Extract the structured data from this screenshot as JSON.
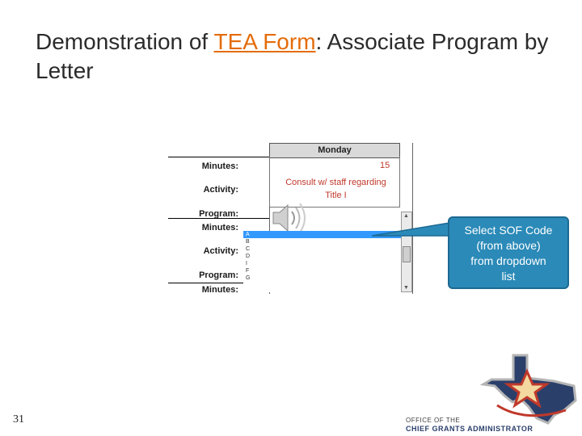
{
  "slide": {
    "title_prefix": "Demonstration of ",
    "title_link": "TEA Form",
    "title_suffix": ": Associate Program by Letter",
    "number": "31"
  },
  "form": {
    "column_header": "Monday",
    "labels": {
      "minutes_1": "Minutes:",
      "activity_1": "Activity:",
      "program_1": "Program:",
      "minutes_2": "Minutes:",
      "activity_2": "Activity:",
      "program_2": "Program:",
      "minutes_3": "Minutes:"
    },
    "minutes_value": "15",
    "activity_line1": "Consult w/ staff regarding",
    "activity_line2": "Title I",
    "dropdown_items": [
      "A",
      "B",
      "C",
      "D",
      "I",
      "F",
      "G"
    ],
    "selected_item": "A"
  },
  "callout": {
    "text_line1": "Select SOF Code",
    "text_line2": "(from above)",
    "text_line3": "from dropdown",
    "text_line4": "list"
  },
  "logo": {
    "line1": "OFFICE OF THE",
    "line2": "CHIEF GRANTS ADMINISTRATOR"
  },
  "colors": {
    "callout": "#2b8ab8",
    "link": "#e46c0a",
    "selection": "#3399ff",
    "texas_blue": "#2b3f6b",
    "texas_red": "#c0392b"
  }
}
